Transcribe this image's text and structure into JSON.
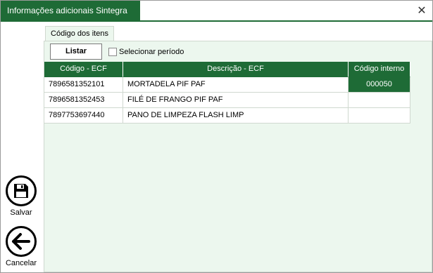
{
  "window": {
    "title": "Informações adicionais Sintegra",
    "close_glyph": "✕"
  },
  "sidebar": {
    "save_label": "Salvar",
    "save_icon": "floppy-disk-icon",
    "cancel_label": "Cancelar",
    "cancel_icon": "arrow-left-icon"
  },
  "tab": {
    "label": "Código dos itens"
  },
  "toolbar": {
    "list_label": "Listar",
    "period_label": "Selecionar período",
    "period_checked": false
  },
  "grid": {
    "columns": [
      "Código - ECF",
      "Descrição - ECF",
      "Código interno"
    ],
    "rows": [
      {
        "code": "7896581352101",
        "desc": "MORTADELA PIF PAF",
        "internal": "000050"
      },
      {
        "code": "7896581352453",
        "desc": "FILÉ DE FRANGO PIF PAF",
        "internal": ""
      },
      {
        "code": "7897753697440",
        "desc": "PANO DE LIMPEZA FLASH LIMP",
        "internal": ""
      }
    ]
  },
  "colors": {
    "accent": "#1e6b36",
    "panel": "#ecf7ee"
  }
}
